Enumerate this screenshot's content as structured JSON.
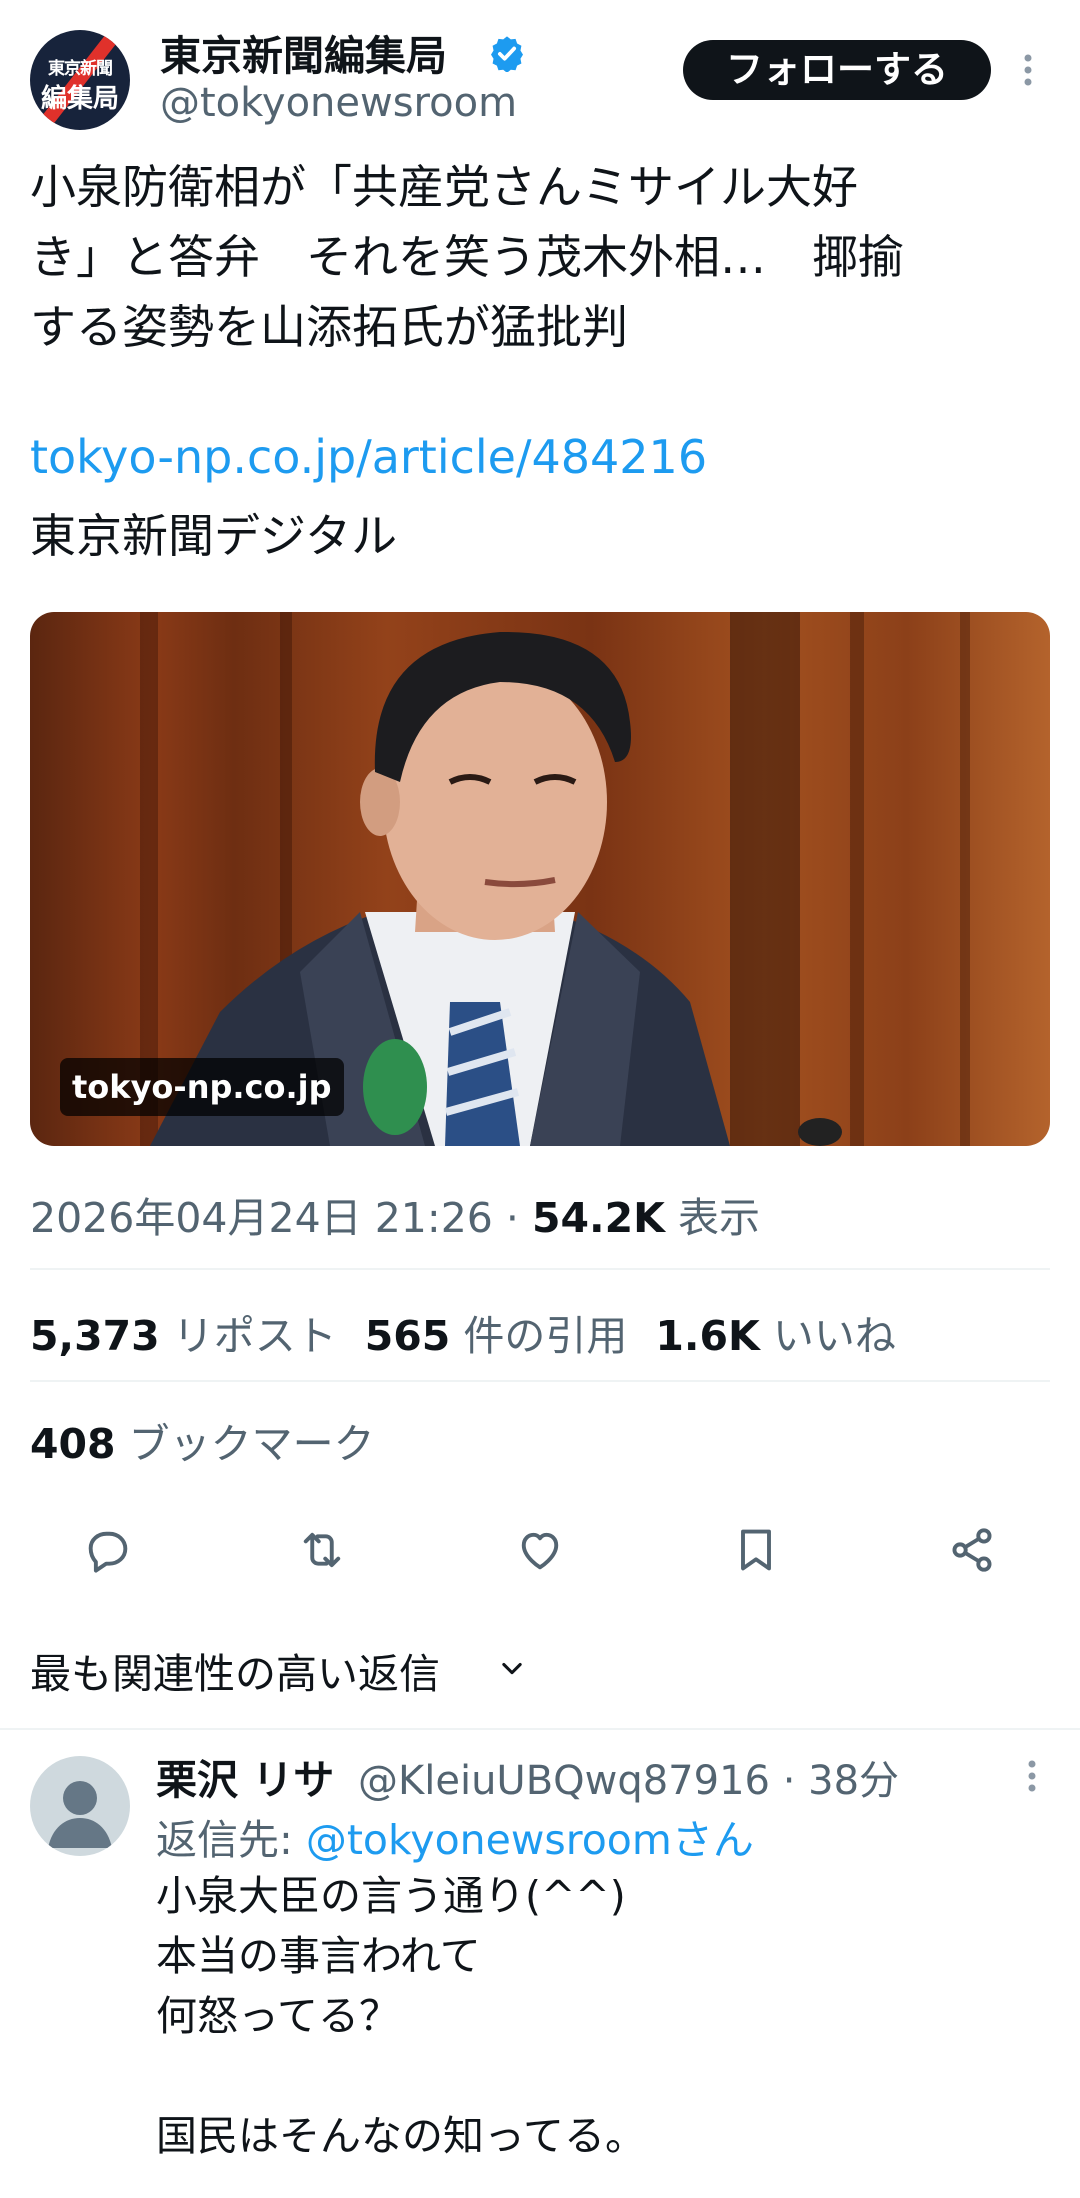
{
  "account": {
    "name": "東京新聞編集局",
    "handle": "@tokyonewsroom",
    "avatar_line1": "東京新聞",
    "avatar_line2": "編集局",
    "follow_label": "フォローする"
  },
  "tweet": {
    "text": "小泉防衛相が「共産党さんミサイル大好\nき」と答弁　それを笑う茂木外相…　揶揄\nする姿勢を山添拓氏が猛批判",
    "link": "tokyo-np.co.jp/article/484216",
    "source": "東京新聞デジタル",
    "card_domain": "tokyo-np.co.jp",
    "timestamp": "2026年04月24日 21:26",
    "separator": " · ",
    "views": "54.2K",
    "views_label": "表示"
  },
  "stats": {
    "reposts": "5,373",
    "reposts_label": "リポスト",
    "quotes": "565",
    "quotes_label": "件の引用",
    "likes": "1.6K",
    "likes_label": "いいね",
    "bookmarks": "408",
    "bookmarks_label": "ブックマーク"
  },
  "actions": [
    "reply-icon",
    "repost-icon",
    "like-icon",
    "bookmark-icon",
    "share-icon"
  ],
  "sort": {
    "label": "最も関連性の高い返信"
  },
  "reply": {
    "name": "栗沢 リサ",
    "handle": "@KleiuUBQwq87916",
    "separator": " · ",
    "time": "38分",
    "reply_to_prefix": "返信先: ",
    "reply_to": "@tokyonewsroomさん",
    "text": "小泉大臣の言う通り(^^)\n本当の事言われて\n何怒ってる？\n\n国民はそんなの知ってる。"
  },
  "colors": {
    "accent": "#1d9bf0",
    "text": "#0f1419",
    "muted": "#536471",
    "divider": "#eff3f4"
  }
}
